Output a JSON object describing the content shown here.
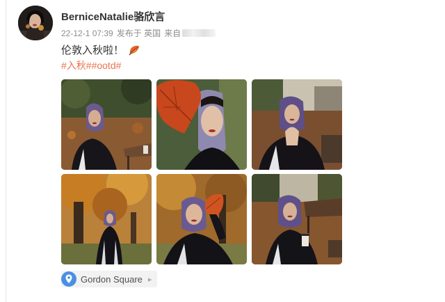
{
  "user": {
    "name": "BerniceNatalie骆欣言"
  },
  "meta": {
    "date": "22-12-1 07:39",
    "location_prefix": "发布于 英国",
    "source_prefix": "来自"
  },
  "post": {
    "text": "伦敦入秋啦！",
    "emoji": "fallen-leaf-icon",
    "hashtags": "#入秋##ootd#"
  },
  "photos": [
    {
      "name": "photo-1",
      "scene": "park-bench"
    },
    {
      "name": "photo-2",
      "scene": "leaf-closeup"
    },
    {
      "name": "photo-3",
      "scene": "hands-chin"
    },
    {
      "name": "photo-4",
      "scene": "autumn-tree"
    },
    {
      "name": "photo-5",
      "scene": "holding-leaf"
    },
    {
      "name": "photo-6",
      "scene": "coffee-bench"
    }
  ],
  "location_tag": {
    "label": "Gordon Square",
    "icon": "map-pin-icon"
  },
  "colors": {
    "hashtag": "#eb7350",
    "username": "#333333",
    "meta": "#8c8c8c",
    "pin": "#4a90e2"
  }
}
